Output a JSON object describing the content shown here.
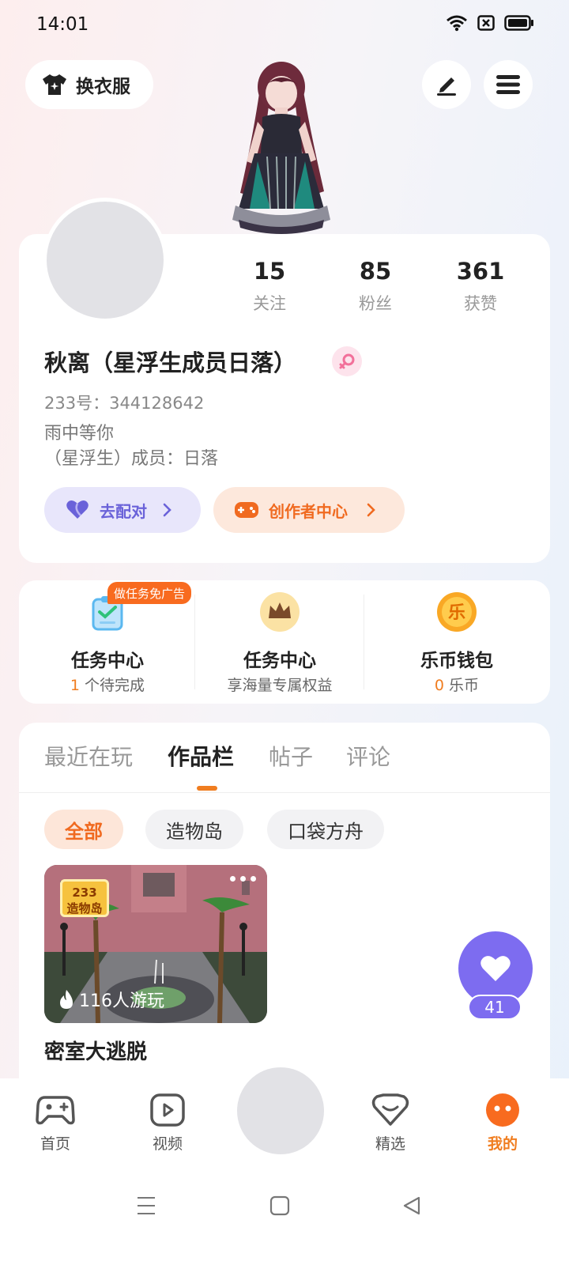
{
  "status_bar": {
    "time": "14:01"
  },
  "header": {
    "outfit_label": "换衣服"
  },
  "profile": {
    "stats": [
      {
        "value": "15",
        "label": "关注"
      },
      {
        "value": "85",
        "label": "粉丝"
      },
      {
        "value": "361",
        "label": "获赞"
      }
    ],
    "name": "秋离（星浮生成员日落）",
    "id_text": "233号：344128642",
    "bio_line1": "雨中等你",
    "bio_line2": "（星浮生）成员：日落",
    "match_label": "去配对",
    "creator_label": "创作者中心"
  },
  "services": [
    {
      "title": "任务中心",
      "count": "1",
      "sub": " 个待完成",
      "badge": "做任务免广告"
    },
    {
      "title": "任务中心",
      "sub": "享海量专属权益"
    },
    {
      "title": "乐币钱包",
      "count": "0",
      "sub": " 乐币",
      "icon_text": "乐"
    }
  ],
  "tabs": [
    {
      "label": "最近在玩"
    },
    {
      "label": "作品栏"
    },
    {
      "label": "帖子"
    },
    {
      "label": "评论"
    }
  ],
  "chips": [
    {
      "label": "全部"
    },
    {
      "label": "造物岛"
    },
    {
      "label": "口袋方舟"
    }
  ],
  "work": {
    "logo_top": "233",
    "logo_bottom": "造物岛",
    "players": "116人游玩",
    "title": "密室大逃脱"
  },
  "like": {
    "count": "41"
  },
  "bottom_nav": [
    {
      "label": "首页"
    },
    {
      "label": "视频"
    },
    {
      "label": "精选"
    },
    {
      "label": "我的"
    }
  ],
  "colors": {
    "accent": "#f07d20",
    "like": "#7d6cf0",
    "match": "#6a62d9"
  }
}
